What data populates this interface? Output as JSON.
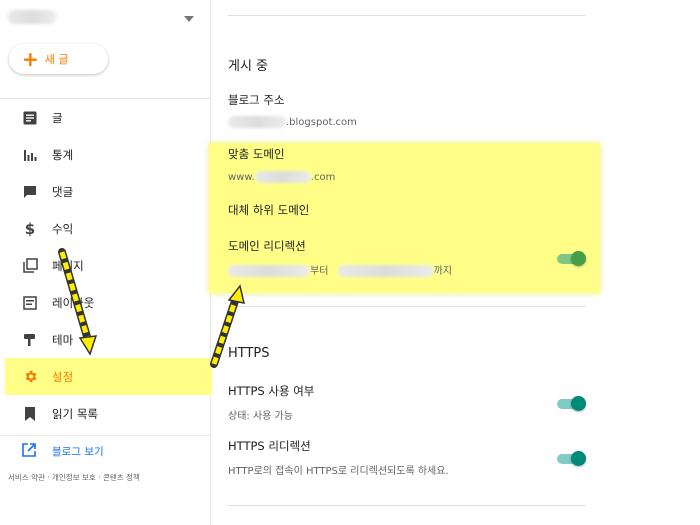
{
  "sidebar": {
    "new_post_label": "새 글",
    "items": [
      {
        "label": "글",
        "icon": "posts-icon"
      },
      {
        "label": "통계",
        "icon": "stats-icon"
      },
      {
        "label": "댓글",
        "icon": "comments-icon"
      },
      {
        "label": "수익",
        "icon": "earnings-icon"
      },
      {
        "label": "페이지",
        "icon": "pages-icon"
      },
      {
        "label": "레이아웃",
        "icon": "layout-icon"
      },
      {
        "label": "테마",
        "icon": "theme-icon"
      },
      {
        "label": "설정",
        "icon": "settings-icon",
        "active": true
      },
      {
        "label": "읽기 목록",
        "icon": "reading-list-icon"
      }
    ],
    "view_blog_label": "블로그 보기",
    "footer": "서비스 약관 · 개인정보 보호 · 콘텐츠 정책"
  },
  "main": {
    "publishing": {
      "title": "게시 중",
      "blog_address": {
        "label": "블로그 주소",
        "value_suffix": ".blogspot.com"
      },
      "custom_domain": {
        "label": "맞춤 도메인",
        "value_prefix": "www.",
        "value_suffix": ".com"
      },
      "fallback_subdomain": {
        "label": "대체 하위 도메인"
      },
      "domain_redirect": {
        "label": "도메인 리디렉션",
        "from_suffix": "부터",
        "to_suffix": "까지",
        "enabled": true
      }
    },
    "https": {
      "title": "HTTPS",
      "availability": {
        "label": "HTTPS 사용 여부",
        "status": "상태: 사용 가능",
        "enabled": true
      },
      "redirect": {
        "label": "HTTPS 리디렉션",
        "desc": "HTTP로의 접속이 HTTPS로 리디렉션되도록 하세요.",
        "enabled": true
      }
    }
  },
  "colors": {
    "accent": "#f57c00",
    "link": "#1a73e8",
    "highlight": "#ffff88",
    "toggle_green": "#43a047",
    "toggle_teal": "#00897b"
  }
}
